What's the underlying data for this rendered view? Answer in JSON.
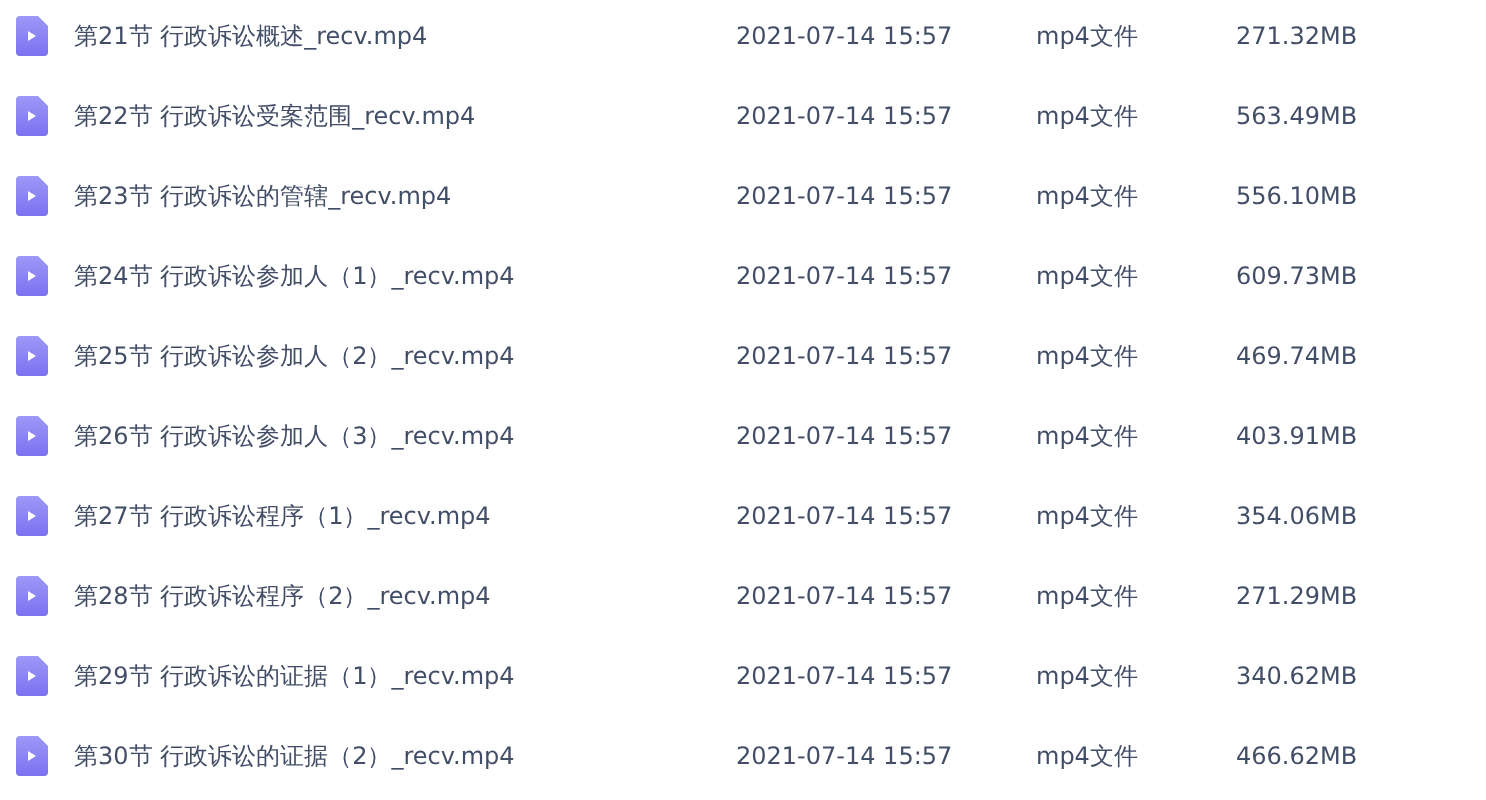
{
  "files": [
    {
      "name": "第21节 行政诉讼概述_recv.mp4",
      "modified": "2021-07-14 15:57",
      "type": "mp4文件",
      "size": "271.32MB"
    },
    {
      "name": "第22节 行政诉讼受案范围_recv.mp4",
      "modified": "2021-07-14 15:57",
      "type": "mp4文件",
      "size": "563.49MB"
    },
    {
      "name": "第23节 行政诉讼的管辖_recv.mp4",
      "modified": "2021-07-14 15:57",
      "type": "mp4文件",
      "size": "556.10MB"
    },
    {
      "name": "第24节 行政诉讼参加人（1）_recv.mp4",
      "modified": "2021-07-14 15:57",
      "type": "mp4文件",
      "size": "609.73MB"
    },
    {
      "name": "第25节 行政诉讼参加人（2）_recv.mp4",
      "modified": "2021-07-14 15:57",
      "type": "mp4文件",
      "size": "469.74MB"
    },
    {
      "name": "第26节 行政诉讼参加人（3）_recv.mp4",
      "modified": "2021-07-14 15:57",
      "type": "mp4文件",
      "size": "403.91MB"
    },
    {
      "name": "第27节 行政诉讼程序（1）_recv.mp4",
      "modified": "2021-07-14 15:57",
      "type": "mp4文件",
      "size": "354.06MB"
    },
    {
      "name": "第28节 行政诉讼程序（2）_recv.mp4",
      "modified": "2021-07-14 15:57",
      "type": "mp4文件",
      "size": "271.29MB"
    },
    {
      "name": "第29节 行政诉讼的证据（1）_recv.mp4",
      "modified": "2021-07-14 15:57",
      "type": "mp4文件",
      "size": "340.62MB"
    },
    {
      "name": "第30节 行政诉讼的证据（2）_recv.mp4",
      "modified": "2021-07-14 15:57",
      "type": "mp4文件",
      "size": "466.62MB"
    }
  ]
}
